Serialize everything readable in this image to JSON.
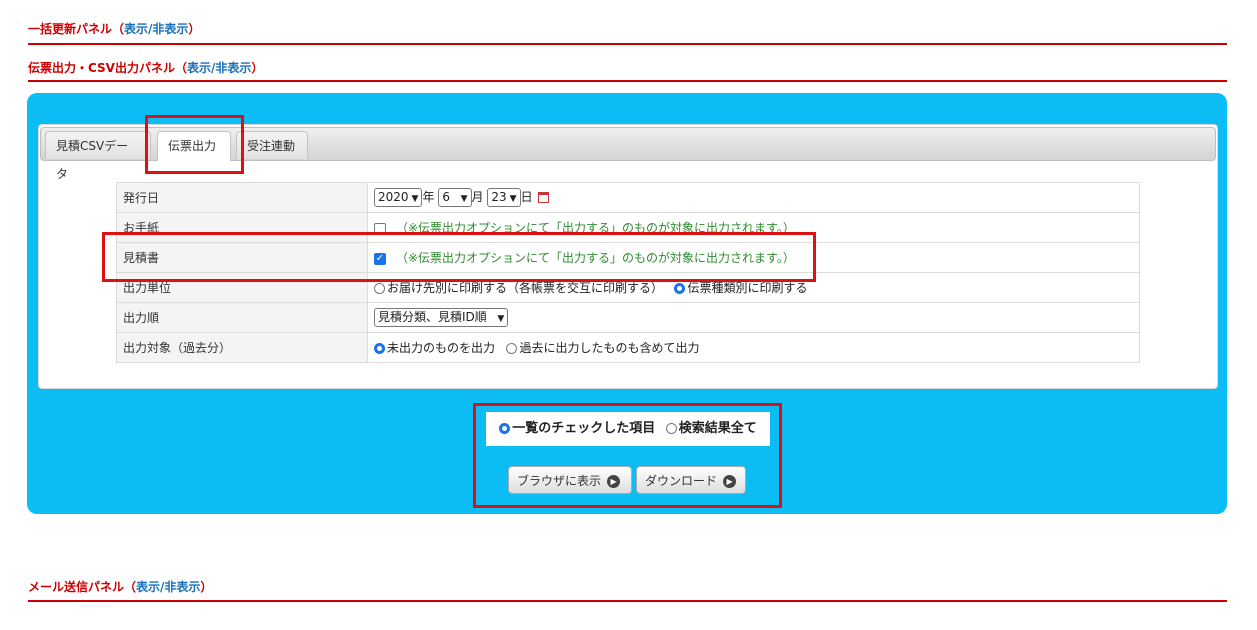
{
  "panels": {
    "bulk_update": {
      "title": "一括更新パネル",
      "toggle": "表示/非表示"
    },
    "slip_output": {
      "title": "伝票出力・CSV出力パネル",
      "toggle": "表示/非表示"
    },
    "mail": {
      "title": "メール送信パネル",
      "toggle": "表示/非表示"
    }
  },
  "tabs": [
    {
      "label": "見積CSVデータ"
    },
    {
      "label": "伝票出力"
    },
    {
      "label": "受注連動"
    }
  ],
  "form": {
    "issue_date": {
      "label": "発行日",
      "year": "2020",
      "year_unit": "年",
      "month": "6",
      "month_unit": "月",
      "day": "23",
      "day_unit": "日"
    },
    "letter": {
      "label": "お手紙",
      "note": "（※伝票出力オプションにて「出力する」のものが対象に出力されます。）",
      "checked": false
    },
    "estimate": {
      "label": "見積書",
      "note": "（※伝票出力オプションにて「出力する」のものが対象に出力されます。）",
      "checked": true
    },
    "output_unit": {
      "label": "出力単位",
      "option1": "お届け先別に印刷する（各帳票を交互に印刷する）",
      "option2": "伝票種類別に印刷する"
    },
    "output_order": {
      "label": "出力順",
      "value": "見積分類、見積ID順"
    },
    "output_target": {
      "label": "出力対象（過去分）",
      "option1": "未出力のものを出力",
      "option2": "過去に出力したものも含めて出力"
    }
  },
  "scope": {
    "option1": "一覧のチェックした項目",
    "option2": "検索結果全て"
  },
  "buttons": {
    "browser": "ブラウザに表示",
    "download": "ダウンロード"
  },
  "colors": {
    "accent_red": "#cc0000",
    "panel_blue": "#0bbcf5",
    "link_blue": "#1a6fb8",
    "note_green": "#2e8b2e",
    "highlight_red": "#dd1111"
  }
}
